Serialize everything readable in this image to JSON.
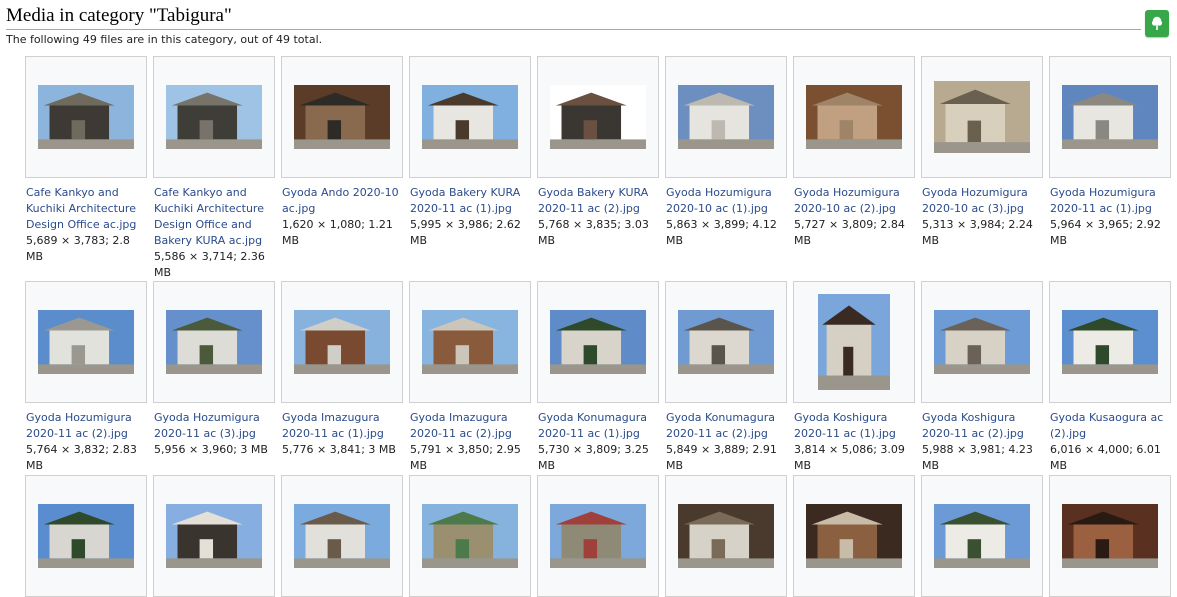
{
  "page": {
    "heading": "Media in category \"Tabigura\"",
    "summary": "The following 49 files are in this category, out of 49 total.",
    "upload_icon": "tree-upload-icon",
    "accent": "#36a84a",
    "link_color": "#2a4b8d"
  },
  "gallery": {
    "items": [
      {
        "title": "Cafe Kankyo and Kuchiki Architecture Design Office ac.jpg",
        "meta": "5,689 × 3,783; 2.8 MB",
        "palette": [
          "#8cb4dc",
          "#3d3a35",
          "#6e6a5e"
        ]
      },
      {
        "title": "Cafe Kankyo and Kuchiki Architecture Design Office and Bakery KURA ac.jpg",
        "meta": "5,586 × 3,714; 2.36 MB",
        "palette": [
          "#9ec3e4",
          "#3f3d38",
          "#77736a"
        ]
      },
      {
        "title": "Gyoda Ando 2020-10 ac.jpg",
        "meta": "1,620 × 1,080; 1.21 MB",
        "palette": [
          "#5a3c28",
          "#8a6a4e",
          "#2e2a26"
        ]
      },
      {
        "title": "Gyoda Bakery KURA 2020-11 ac (1).jpg",
        "meta": "5,995 × 3,986; 2.62 MB",
        "palette": [
          "#7fb0e0",
          "#e8e6e0",
          "#4a3a2c"
        ]
      },
      {
        "title": "Gyoda Bakery KURA 2020-11 ac (2).jpg",
        "meta": "5,768 × 3,835; 3.03 MB",
        "palette": [
          "#ffffff",
          "#3a3632",
          "#6a5040"
        ]
      },
      {
        "title": "Gyoda Hozumigura 2020-10 ac (1).jpg",
        "meta": "5,863 × 3,899; 4.12 MB",
        "palette": [
          "#6c8fc0",
          "#e6e4de",
          "#bdb9b0"
        ]
      },
      {
        "title": "Gyoda Hozumigura 2020-10 ac (2).jpg",
        "meta": "5,727 × 3,809; 2.84 MB",
        "palette": [
          "#7a5030",
          "#c0a080",
          "#a08468"
        ]
      },
      {
        "title": "Gyoda Hozumigura 2020-10 ac (3).jpg",
        "meta": "5,313 × 3,984; 2.24 MB",
        "palette": [
          "#b8aa90",
          "#d8cfbc",
          "#6a6050"
        ]
      },
      {
        "title": "Gyoda Hozumigura 2020-11 ac (1).jpg",
        "meta": "5,964 × 3,965; 2.92 MB",
        "palette": [
          "#5f86bf",
          "#e8e6e0",
          "#8a8880"
        ]
      },
      {
        "title": "Gyoda Hozumigura 2020-11 ac (2).jpg",
        "meta": "5,764 × 3,832; 2.83 MB",
        "palette": [
          "#5b8ccc",
          "#e2e2dc",
          "#9a9890"
        ]
      },
      {
        "title": "Gyoda Hozumigura 2020-11 ac (3).jpg",
        "meta": "5,956 × 3,960; 3 MB",
        "palette": [
          "#6590cc",
          "#dedcd6",
          "#4a5a3a"
        ]
      },
      {
        "title": "Gyoda Imazugura 2020-11 ac (1).jpg",
        "meta": "5,776 × 3,841; 3 MB",
        "palette": [
          "#88b2de",
          "#7a4a30",
          "#cfcfc8"
        ]
      },
      {
        "title": "Gyoda Imazugura 2020-11 ac (2).jpg",
        "meta": "5,791 × 3,850; 2.95 MB",
        "palette": [
          "#88b4e0",
          "#8a5a3c",
          "#cbc5ba"
        ]
      },
      {
        "title": "Gyoda Konumagura 2020-11 ac (1).jpg",
        "meta": "5,730 × 3,809; 3.25 MB",
        "palette": [
          "#5f8cc8",
          "#d8d4cc",
          "#2e4a2a"
        ]
      },
      {
        "title": "Gyoda Konumagura 2020-11 ac (2).jpg",
        "meta": "5,849 × 3,889; 2.91 MB",
        "palette": [
          "#6f9ad2",
          "#dcd8cf",
          "#5a554c"
        ]
      },
      {
        "title": "Gyoda Koshigura 2020-11 ac (1).jpg",
        "meta": "3,814 × 5,086; 3.09 MB",
        "palette": [
          "#7aa6dc",
          "#d6d0c4",
          "#3a2a22"
        ]
      },
      {
        "title": "Gyoda Koshigura 2020-11 ac (2).jpg",
        "meta": "5,988 × 3,981; 4.23 MB",
        "palette": [
          "#6d9bd6",
          "#d8d2c6",
          "#6a6258"
        ]
      },
      {
        "title": "Gyoda Kusaogura ac (2).jpg",
        "meta": "6,016 × 4,000; 6.01 MB",
        "palette": [
          "#5c8fd0",
          "#ecebe6",
          "#2f4a2a"
        ]
      },
      {
        "title": "",
        "meta": "",
        "palette": [
          "#5a8cd0",
          "#d8d6d0",
          "#2f4a2a"
        ]
      },
      {
        "title": "",
        "meta": "",
        "palette": [
          "#86aee0",
          "#3a342e",
          "#e4e0d8"
        ]
      },
      {
        "title": "",
        "meta": "",
        "palette": [
          "#7aaade",
          "#e2e0da",
          "#6a5a4a"
        ]
      },
      {
        "title": "",
        "meta": "",
        "palette": [
          "#86b2de",
          "#9a9070",
          "#4c7a4a"
        ]
      },
      {
        "title": "",
        "meta": "",
        "palette": [
          "#7ca8dc",
          "#8e8a76",
          "#a0403a"
        ]
      },
      {
        "title": "",
        "meta": "",
        "palette": [
          "#4a3a2e",
          "#d6d2c8",
          "#7a6a58"
        ]
      },
      {
        "title": "",
        "meta": "",
        "palette": [
          "#3a2a20",
          "#8a6040",
          "#c8bca8"
        ]
      },
      {
        "title": "",
        "meta": "",
        "palette": [
          "#6c9ad6",
          "#ecebe6",
          "#3a5030"
        ]
      },
      {
        "title": "",
        "meta": "",
        "palette": [
          "#5a3020",
          "#9a6040",
          "#2a1a14"
        ]
      }
    ]
  }
}
